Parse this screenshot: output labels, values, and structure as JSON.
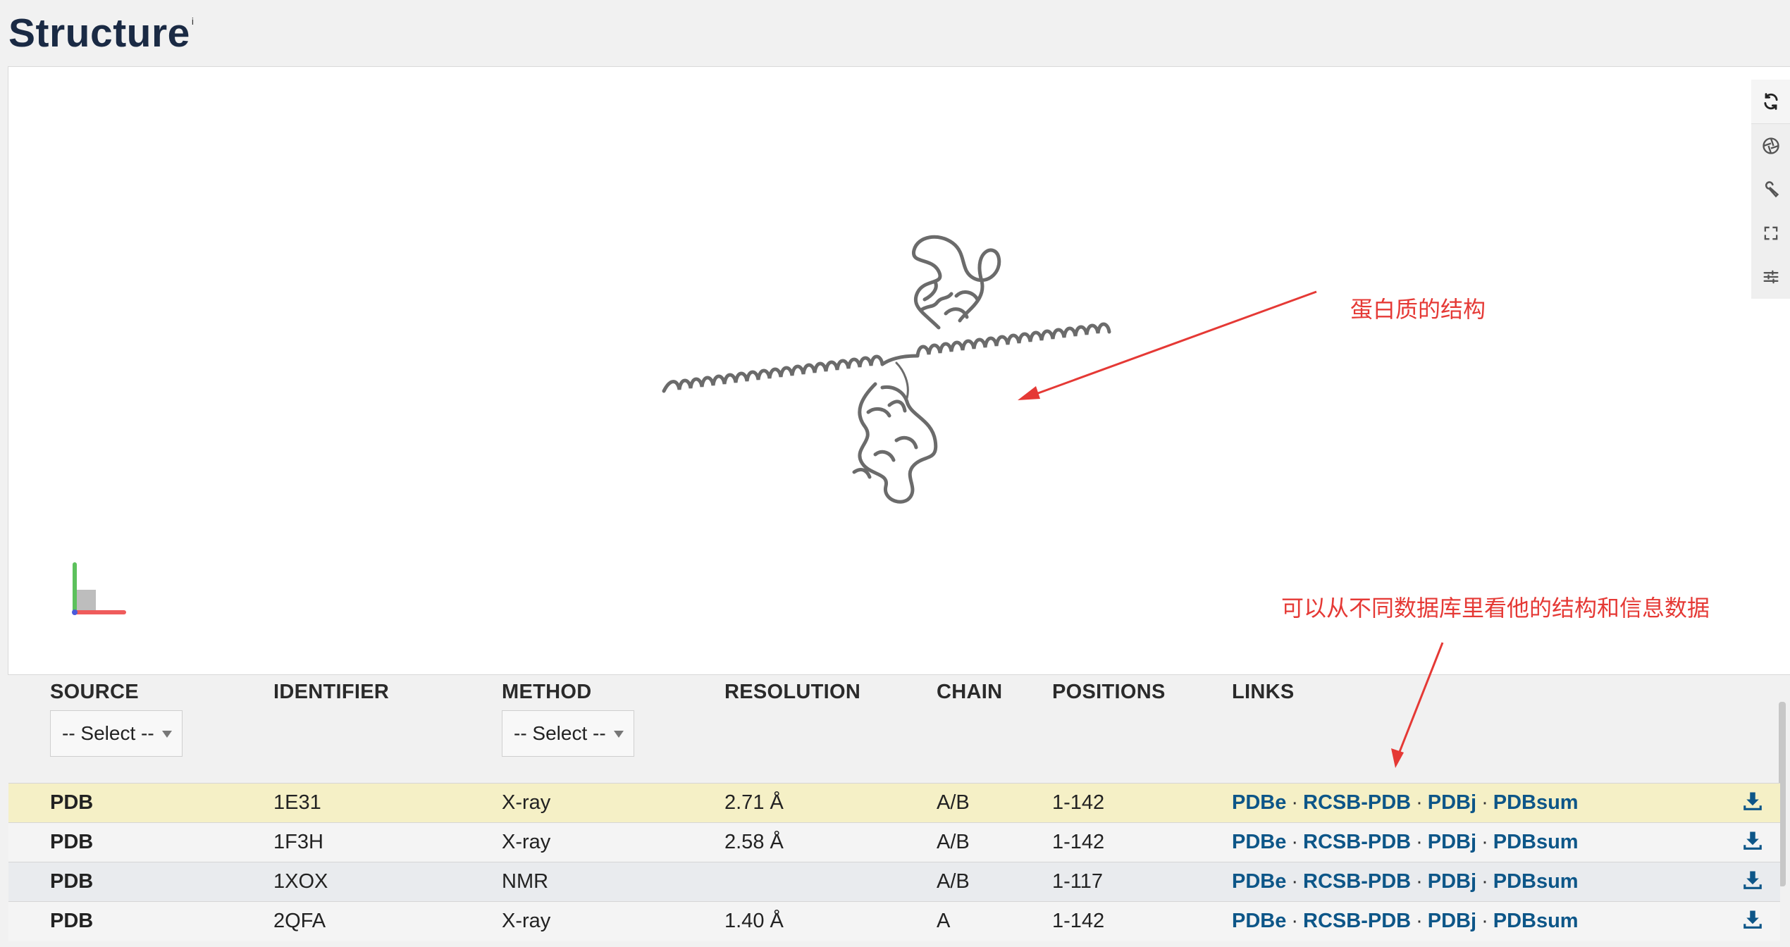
{
  "page": {
    "title": "Structure",
    "info_marker": "i"
  },
  "viewer": {
    "toolbar": [
      {
        "name": "reset-view",
        "icon": "refresh-icon"
      },
      {
        "name": "screenshot",
        "icon": "camera-aperture-icon"
      },
      {
        "name": "tools",
        "icon": "wrench-icon"
      },
      {
        "name": "expand",
        "icon": "fullscreen-icon"
      },
      {
        "name": "settings",
        "icon": "sliders-icon"
      }
    ]
  },
  "annotations": {
    "structure_note": "蛋白质的结构",
    "databases_note": "可以从不同数据库里看他的结构和信息数据"
  },
  "table": {
    "headers": {
      "source": "SOURCE",
      "identifier": "IDENTIFIER",
      "method": "METHOD",
      "resolution": "RESOLUTION",
      "chain": "CHAIN",
      "positions": "POSITIONS",
      "links": "LINKS"
    },
    "filters": {
      "source": "-- Select --",
      "method": "-- Select --"
    },
    "links_labels": [
      "PDBe",
      "RCSB-PDB",
      "PDBj",
      "PDBsum"
    ],
    "rows": [
      {
        "source": "PDB",
        "identifier": "1E31",
        "method": "X-ray",
        "resolution": "2.71 Å",
        "chain": "A/B",
        "positions": "1-142"
      },
      {
        "source": "PDB",
        "identifier": "1F3H",
        "method": "X-ray",
        "resolution": "2.58 Å",
        "chain": "A/B",
        "positions": "1-142"
      },
      {
        "source": "PDB",
        "identifier": "1XOX",
        "method": "NMR",
        "resolution": "",
        "chain": "A/B",
        "positions": "1-117"
      },
      {
        "source": "PDB",
        "identifier": "2QFA",
        "method": "X-ray",
        "resolution": "1.40 Å",
        "chain": "A",
        "positions": "1-142"
      }
    ]
  },
  "colors": {
    "link": "#0d5688",
    "annotation": "#e53935",
    "highlight_row": "#f5f0c6",
    "title": "#1a2a44"
  }
}
